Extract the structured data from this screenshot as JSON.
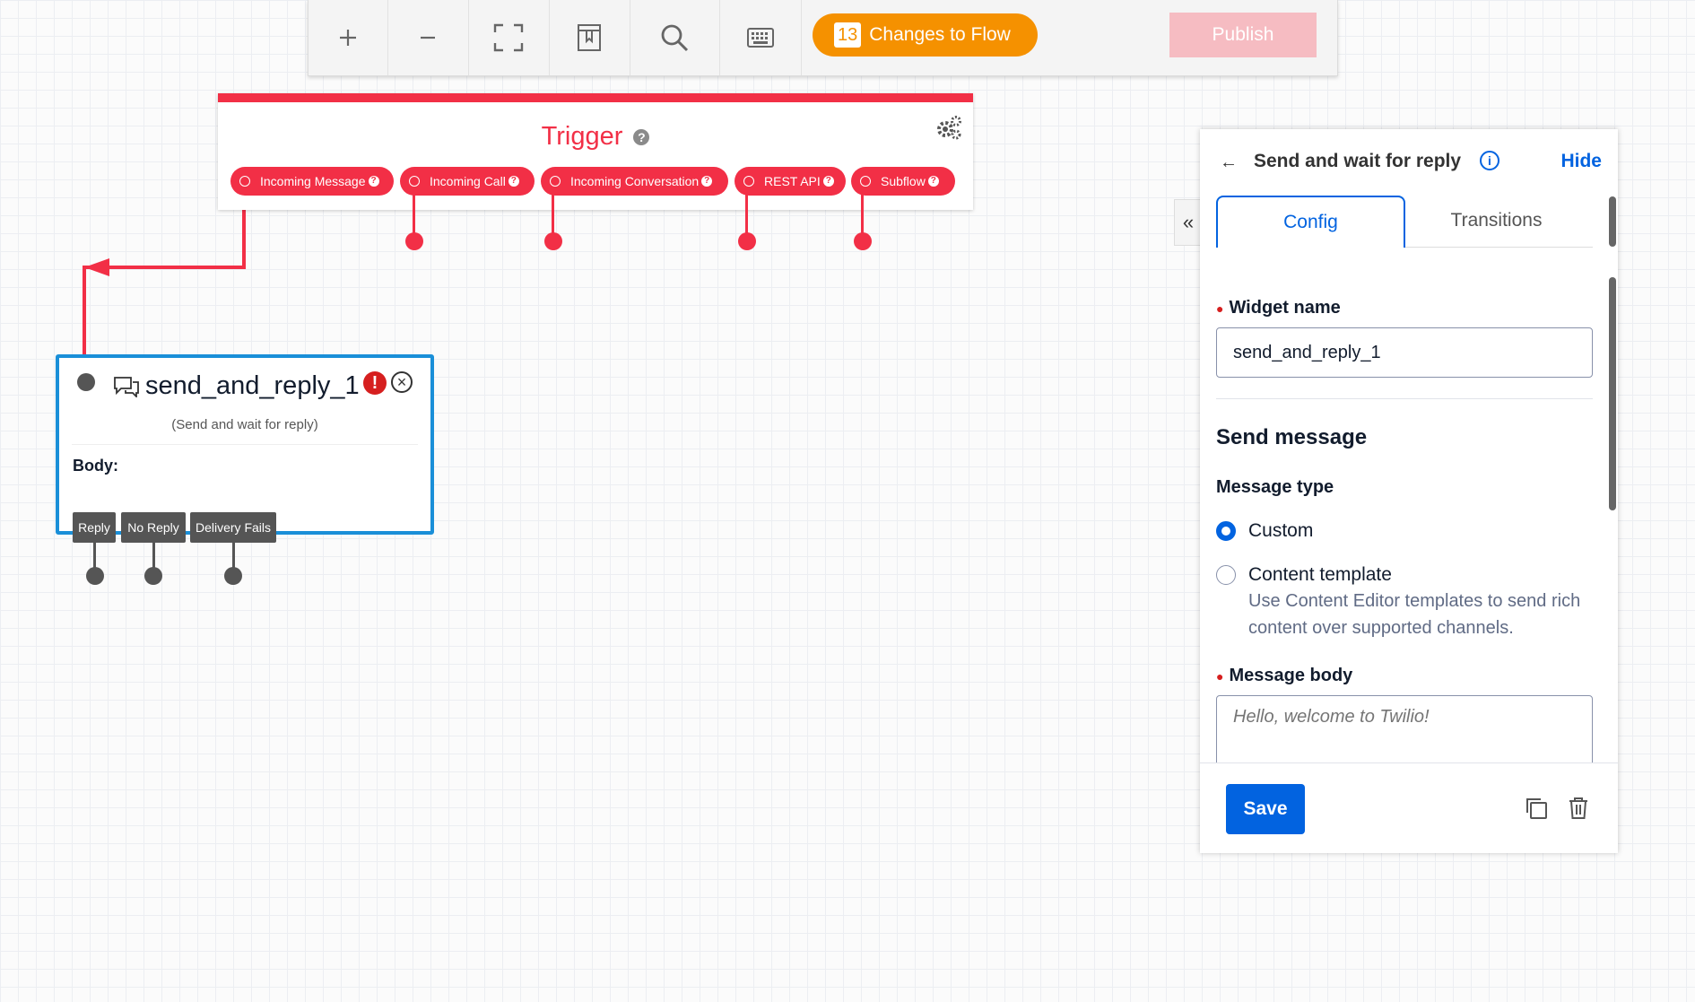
{
  "toolbar": {
    "buttons": [
      "zoom-in-icon",
      "zoom-out-icon",
      "fit-screen-icon",
      "bookmark-icon",
      "search-icon",
      "keyboard-icon"
    ],
    "changes_count": "13",
    "changes_label": "Changes to Flow",
    "publish_label": "Publish",
    "accent": "#f59100"
  },
  "trigger": {
    "title": "Trigger",
    "help": "?",
    "pills": [
      {
        "label": "Incoming Message"
      },
      {
        "label": "Incoming Call"
      },
      {
        "label": "Incoming Conversation"
      },
      {
        "label": "REST API"
      },
      {
        "label": "Subflow"
      }
    ],
    "color": "#f22f46"
  },
  "widget": {
    "name": "send_and_reply_1",
    "type": "(Send and wait for reply)",
    "error_symbol": "!",
    "close_symbol": "×",
    "body_label": "Body:",
    "transitions": [
      "Reply",
      "No Reply",
      "Delivery Fails"
    ]
  },
  "panel": {
    "title": "Send and wait for reply",
    "hide_label": "Hide",
    "info_symbol": "i",
    "collapse_symbol": "«",
    "tabs": [
      {
        "label": "Config"
      },
      {
        "label": "Transitions"
      }
    ],
    "widget_name_label": "Widget name",
    "widget_name_value": "send_and_reply_1",
    "section_title": "Send message",
    "message_type_label": "Message type",
    "options": [
      {
        "label": "Custom",
        "selected": true
      },
      {
        "label": "Content template",
        "selected": false,
        "help": "Use Content Editor templates to send rich content over supported channels."
      }
    ],
    "message_body_label": "Message body",
    "message_body_placeholder": "Hello, welcome to Twilio!",
    "save_label": "Save"
  }
}
